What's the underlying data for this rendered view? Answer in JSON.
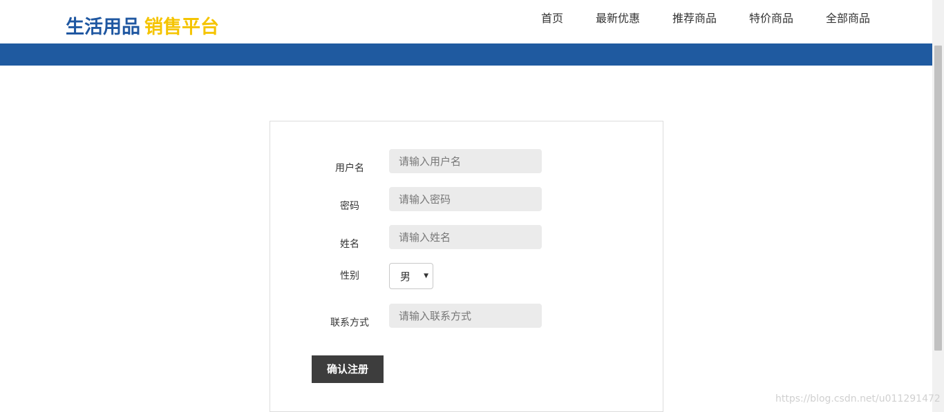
{
  "header": {
    "logo_part1": "生活用品",
    "logo_part2": "销售平台",
    "nav": [
      "首页",
      "最新优惠",
      "推荐商品",
      "特价商品",
      "全部商品"
    ]
  },
  "form": {
    "username_label": "用户名",
    "username_placeholder": "请输入用户名",
    "password_label": "密码",
    "password_placeholder": "请输入密码",
    "name_label": "姓名",
    "name_placeholder": "请输入姓名",
    "gender_label": "性别",
    "gender_value": "男",
    "contact_label": "联系方式",
    "contact_placeholder": "请输入联系方式",
    "submit_label": "确认注册"
  },
  "watermark": "https://blog.csdn.net/u011291472",
  "colors": {
    "brand_blue": "#1f57a1",
    "brand_yellow": "#f5c400",
    "banner": "#1f5aa0",
    "button": "#3d3d3d",
    "input_bg": "#ebebeb"
  }
}
